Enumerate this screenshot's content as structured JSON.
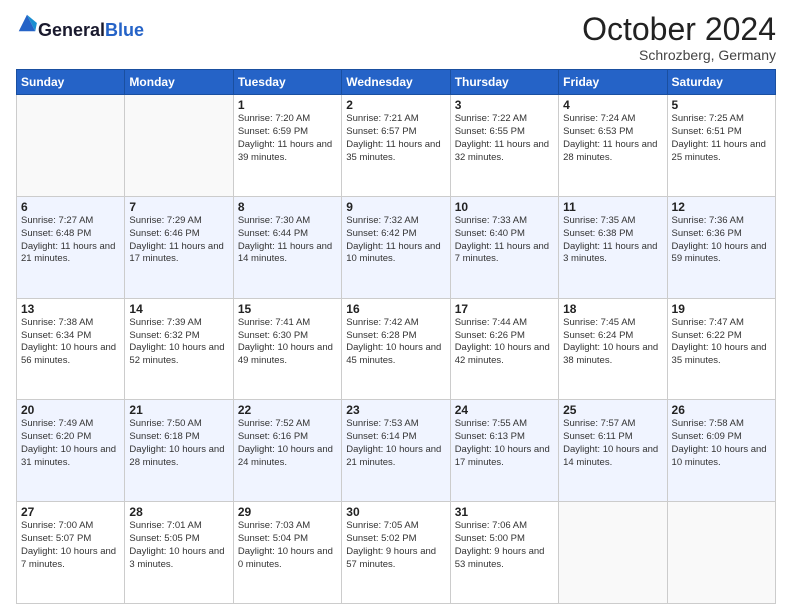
{
  "header": {
    "logo_general": "General",
    "logo_blue": "Blue",
    "month": "October 2024",
    "location": "Schrozberg, Germany"
  },
  "days": [
    "Sunday",
    "Monday",
    "Tuesday",
    "Wednesday",
    "Thursday",
    "Friday",
    "Saturday"
  ],
  "weeks": [
    [
      {
        "day": "",
        "sunrise": "",
        "sunset": "",
        "daylight": ""
      },
      {
        "day": "",
        "sunrise": "",
        "sunset": "",
        "daylight": ""
      },
      {
        "day": "1",
        "sunrise": "Sunrise: 7:20 AM",
        "sunset": "Sunset: 6:59 PM",
        "daylight": "Daylight: 11 hours and 39 minutes."
      },
      {
        "day": "2",
        "sunrise": "Sunrise: 7:21 AM",
        "sunset": "Sunset: 6:57 PM",
        "daylight": "Daylight: 11 hours and 35 minutes."
      },
      {
        "day": "3",
        "sunrise": "Sunrise: 7:22 AM",
        "sunset": "Sunset: 6:55 PM",
        "daylight": "Daylight: 11 hours and 32 minutes."
      },
      {
        "day": "4",
        "sunrise": "Sunrise: 7:24 AM",
        "sunset": "Sunset: 6:53 PM",
        "daylight": "Daylight: 11 hours and 28 minutes."
      },
      {
        "day": "5",
        "sunrise": "Sunrise: 7:25 AM",
        "sunset": "Sunset: 6:51 PM",
        "daylight": "Daylight: 11 hours and 25 minutes."
      }
    ],
    [
      {
        "day": "6",
        "sunrise": "Sunrise: 7:27 AM",
        "sunset": "Sunset: 6:48 PM",
        "daylight": "Daylight: 11 hours and 21 minutes."
      },
      {
        "day": "7",
        "sunrise": "Sunrise: 7:29 AM",
        "sunset": "Sunset: 6:46 PM",
        "daylight": "Daylight: 11 hours and 17 minutes."
      },
      {
        "day": "8",
        "sunrise": "Sunrise: 7:30 AM",
        "sunset": "Sunset: 6:44 PM",
        "daylight": "Daylight: 11 hours and 14 minutes."
      },
      {
        "day": "9",
        "sunrise": "Sunrise: 7:32 AM",
        "sunset": "Sunset: 6:42 PM",
        "daylight": "Daylight: 11 hours and 10 minutes."
      },
      {
        "day": "10",
        "sunrise": "Sunrise: 7:33 AM",
        "sunset": "Sunset: 6:40 PM",
        "daylight": "Daylight: 11 hours and 7 minutes."
      },
      {
        "day": "11",
        "sunrise": "Sunrise: 7:35 AM",
        "sunset": "Sunset: 6:38 PM",
        "daylight": "Daylight: 11 hours and 3 minutes."
      },
      {
        "day": "12",
        "sunrise": "Sunrise: 7:36 AM",
        "sunset": "Sunset: 6:36 PM",
        "daylight": "Daylight: 10 hours and 59 minutes."
      }
    ],
    [
      {
        "day": "13",
        "sunrise": "Sunrise: 7:38 AM",
        "sunset": "Sunset: 6:34 PM",
        "daylight": "Daylight: 10 hours and 56 minutes."
      },
      {
        "day": "14",
        "sunrise": "Sunrise: 7:39 AM",
        "sunset": "Sunset: 6:32 PM",
        "daylight": "Daylight: 10 hours and 52 minutes."
      },
      {
        "day": "15",
        "sunrise": "Sunrise: 7:41 AM",
        "sunset": "Sunset: 6:30 PM",
        "daylight": "Daylight: 10 hours and 49 minutes."
      },
      {
        "day": "16",
        "sunrise": "Sunrise: 7:42 AM",
        "sunset": "Sunset: 6:28 PM",
        "daylight": "Daylight: 10 hours and 45 minutes."
      },
      {
        "day": "17",
        "sunrise": "Sunrise: 7:44 AM",
        "sunset": "Sunset: 6:26 PM",
        "daylight": "Daylight: 10 hours and 42 minutes."
      },
      {
        "day": "18",
        "sunrise": "Sunrise: 7:45 AM",
        "sunset": "Sunset: 6:24 PM",
        "daylight": "Daylight: 10 hours and 38 minutes."
      },
      {
        "day": "19",
        "sunrise": "Sunrise: 7:47 AM",
        "sunset": "Sunset: 6:22 PM",
        "daylight": "Daylight: 10 hours and 35 minutes."
      }
    ],
    [
      {
        "day": "20",
        "sunrise": "Sunrise: 7:49 AM",
        "sunset": "Sunset: 6:20 PM",
        "daylight": "Daylight: 10 hours and 31 minutes."
      },
      {
        "day": "21",
        "sunrise": "Sunrise: 7:50 AM",
        "sunset": "Sunset: 6:18 PM",
        "daylight": "Daylight: 10 hours and 28 minutes."
      },
      {
        "day": "22",
        "sunrise": "Sunrise: 7:52 AM",
        "sunset": "Sunset: 6:16 PM",
        "daylight": "Daylight: 10 hours and 24 minutes."
      },
      {
        "day": "23",
        "sunrise": "Sunrise: 7:53 AM",
        "sunset": "Sunset: 6:14 PM",
        "daylight": "Daylight: 10 hours and 21 minutes."
      },
      {
        "day": "24",
        "sunrise": "Sunrise: 7:55 AM",
        "sunset": "Sunset: 6:13 PM",
        "daylight": "Daylight: 10 hours and 17 minutes."
      },
      {
        "day": "25",
        "sunrise": "Sunrise: 7:57 AM",
        "sunset": "Sunset: 6:11 PM",
        "daylight": "Daylight: 10 hours and 14 minutes."
      },
      {
        "day": "26",
        "sunrise": "Sunrise: 7:58 AM",
        "sunset": "Sunset: 6:09 PM",
        "daylight": "Daylight: 10 hours and 10 minutes."
      }
    ],
    [
      {
        "day": "27",
        "sunrise": "Sunrise: 7:00 AM",
        "sunset": "Sunset: 5:07 PM",
        "daylight": "Daylight: 10 hours and 7 minutes."
      },
      {
        "day": "28",
        "sunrise": "Sunrise: 7:01 AM",
        "sunset": "Sunset: 5:05 PM",
        "daylight": "Daylight: 10 hours and 3 minutes."
      },
      {
        "day": "29",
        "sunrise": "Sunrise: 7:03 AM",
        "sunset": "Sunset: 5:04 PM",
        "daylight": "Daylight: 10 hours and 0 minutes."
      },
      {
        "day": "30",
        "sunrise": "Sunrise: 7:05 AM",
        "sunset": "Sunset: 5:02 PM",
        "daylight": "Daylight: 9 hours and 57 minutes."
      },
      {
        "day": "31",
        "sunrise": "Sunrise: 7:06 AM",
        "sunset": "Sunset: 5:00 PM",
        "daylight": "Daylight: 9 hours and 53 minutes."
      },
      {
        "day": "",
        "sunrise": "",
        "sunset": "",
        "daylight": ""
      },
      {
        "day": "",
        "sunrise": "",
        "sunset": "",
        "daylight": ""
      }
    ]
  ]
}
